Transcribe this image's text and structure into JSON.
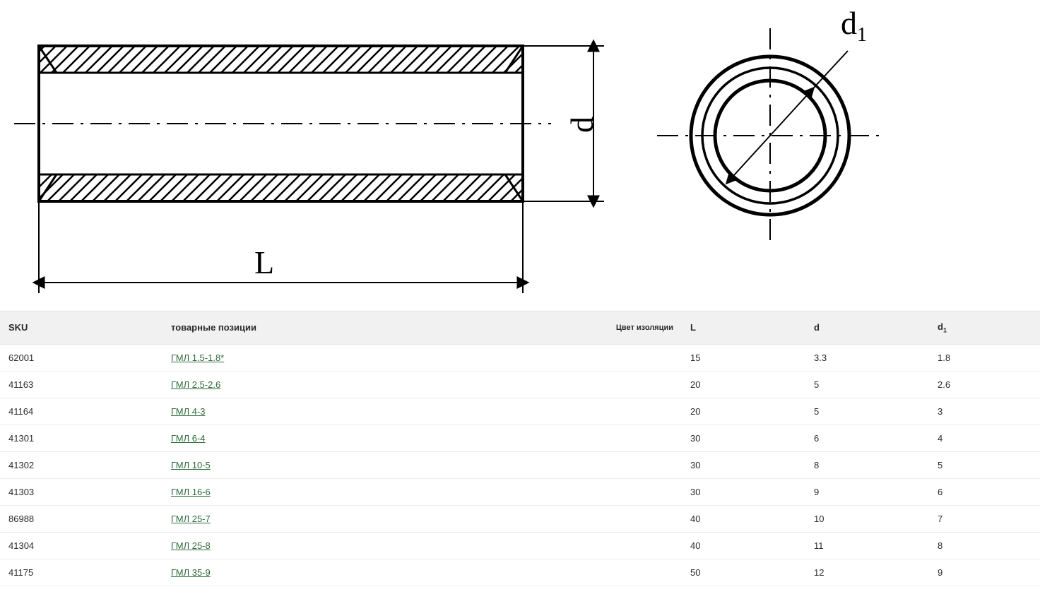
{
  "diagram": {
    "label_L": "L",
    "label_d": "d",
    "label_d1_main": "d",
    "label_d1_sub": "1"
  },
  "table": {
    "headers": {
      "sku": "SKU",
      "name_left": "товарные позиции",
      "name_right": "Цвет изоляции",
      "L": "L",
      "d": "d",
      "d1_main": "d",
      "d1_sub": "1"
    },
    "rows": [
      {
        "sku": "62001",
        "name": "ГМЛ 1.5-1.8*",
        "L": "15",
        "d": "3.3",
        "d1": "1.8"
      },
      {
        "sku": "41163",
        "name": "ГМЛ 2.5-2.6",
        "L": "20",
        "d": "5",
        "d1": "2.6"
      },
      {
        "sku": "41164",
        "name": "ГМЛ 4-3",
        "L": "20",
        "d": "5",
        "d1": "3"
      },
      {
        "sku": "41301",
        "name": "ГМЛ 6-4",
        "L": "30",
        "d": "6",
        "d1": "4"
      },
      {
        "sku": "41302",
        "name": "ГМЛ 10-5",
        "L": "30",
        "d": "8",
        "d1": "5"
      },
      {
        "sku": "41303",
        "name": "ГМЛ 16-6",
        "L": "30",
        "d": "9",
        "d1": "6"
      },
      {
        "sku": "86988",
        "name": "ГМЛ 25-7",
        "L": "40",
        "d": "10",
        "d1": "7"
      },
      {
        "sku": "41304",
        "name": "ГМЛ 25-8",
        "L": "40",
        "d": "11",
        "d1": "8"
      },
      {
        "sku": "41175",
        "name": "ГМЛ 35-9",
        "L": "50",
        "d": "12",
        "d1": "9"
      }
    ]
  }
}
